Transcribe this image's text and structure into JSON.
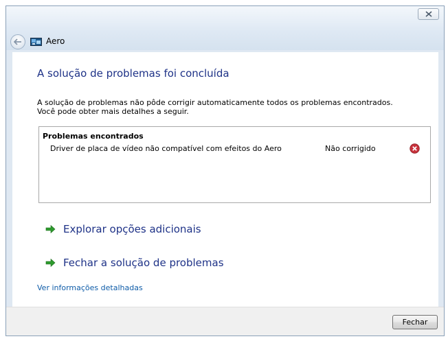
{
  "window": {
    "title": "Aero"
  },
  "header": {
    "title": "A solução de problemas foi concluída"
  },
  "description": {
    "line1": "A solução de problemas não pôde corrigir automaticamente todos os problemas encontrados.",
    "line2": "Você pode obter mais detalhes a seguir."
  },
  "problems": {
    "header": "Problemas encontrados",
    "items": [
      {
        "description": "Driver de placa de vídeo não compatível com efeitos do Aero",
        "status": "Não corrigido",
        "status_icon": "error-icon"
      }
    ]
  },
  "actions": [
    {
      "label": "Explorar opções adicionais",
      "icon": "green-arrow-icon"
    },
    {
      "label": "Fechar a solução de problemas",
      "icon": "green-arrow-icon"
    }
  ],
  "details_link": "Ver informações detalhadas",
  "footer": {
    "close_label": "Fechar"
  },
  "colors": {
    "heading": "#1e3287",
    "link": "#0f5ca8",
    "error": "#c8323c",
    "arrow": "#2e9b2e"
  }
}
